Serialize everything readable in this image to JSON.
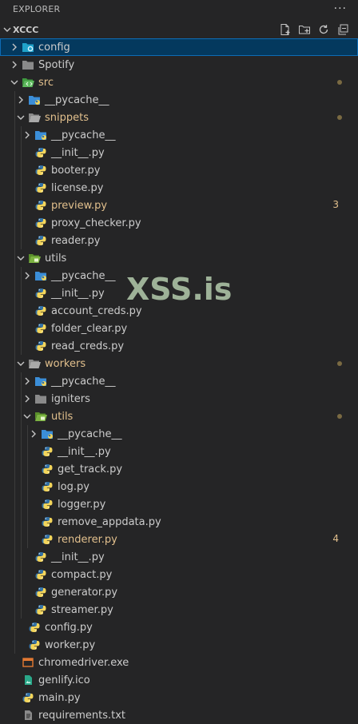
{
  "header": {
    "title": "EXPLORER",
    "more": "···"
  },
  "workspace": {
    "name": "XCCC"
  },
  "watermark": "XSS.is",
  "colors": {
    "modified": "#e2c08d",
    "normal": "#cccccc",
    "selected": "#04395e",
    "folder": "#c09553",
    "python_blue": "#3572A5",
    "python_yellow": "#f3d55b"
  },
  "tree": [
    {
      "label": "config",
      "depth": 1,
      "kind": "folder-config",
      "expanded": false,
      "selected": true,
      "status": "normal"
    },
    {
      "label": "Spotify",
      "depth": 1,
      "kind": "folder",
      "expanded": false,
      "status": "normal"
    },
    {
      "label": "src",
      "depth": 1,
      "kind": "folder-src",
      "expanded": true,
      "status": "modified",
      "dot": true
    },
    {
      "label": "__pycache__",
      "depth": 2,
      "kind": "folder-pycache",
      "expanded": false,
      "status": "normal"
    },
    {
      "label": "snippets",
      "depth": 2,
      "kind": "folder",
      "expanded": true,
      "status": "modified",
      "dot": true
    },
    {
      "label": "__pycache__",
      "depth": 3,
      "kind": "folder-pycache",
      "expanded": false,
      "status": "normal"
    },
    {
      "label": "__init__.py",
      "depth": 3,
      "kind": "python",
      "status": "normal"
    },
    {
      "label": "booter.py",
      "depth": 3,
      "kind": "python",
      "status": "normal"
    },
    {
      "label": "license.py",
      "depth": 3,
      "kind": "python",
      "status": "normal"
    },
    {
      "label": "preview.py",
      "depth": 3,
      "kind": "python",
      "status": "modified",
      "count": "3"
    },
    {
      "label": "proxy_checker.py",
      "depth": 3,
      "kind": "python",
      "status": "normal"
    },
    {
      "label": "reader.py",
      "depth": 3,
      "kind": "python",
      "status": "normal"
    },
    {
      "label": "utils",
      "depth": 2,
      "kind": "folder-utils",
      "expanded": true,
      "status": "normal"
    },
    {
      "label": "__pycache__",
      "depth": 3,
      "kind": "folder-pycache",
      "expanded": false,
      "status": "normal"
    },
    {
      "label": "__init__.py",
      "depth": 3,
      "kind": "python",
      "status": "normal"
    },
    {
      "label": "account_creds.py",
      "depth": 3,
      "kind": "python",
      "status": "normal"
    },
    {
      "label": "folder_clear.py",
      "depth": 3,
      "kind": "python",
      "status": "normal"
    },
    {
      "label": "read_creds.py",
      "depth": 3,
      "kind": "python",
      "status": "normal"
    },
    {
      "label": "workers",
      "depth": 2,
      "kind": "folder",
      "expanded": true,
      "status": "modified",
      "dot": true
    },
    {
      "label": "__pycache__",
      "depth": 3,
      "kind": "folder-pycache",
      "expanded": false,
      "status": "normal"
    },
    {
      "label": "igniters",
      "depth": 3,
      "kind": "folder",
      "expanded": false,
      "status": "normal"
    },
    {
      "label": "utils",
      "depth": 3,
      "kind": "folder-utils",
      "expanded": true,
      "status": "modified",
      "dot": true
    },
    {
      "label": "__pycache__",
      "depth": 4,
      "kind": "folder-pycache",
      "expanded": false,
      "status": "normal"
    },
    {
      "label": "__init__.py",
      "depth": 4,
      "kind": "python",
      "status": "normal"
    },
    {
      "label": "get_track.py",
      "depth": 4,
      "kind": "python",
      "status": "normal"
    },
    {
      "label": "log.py",
      "depth": 4,
      "kind": "python",
      "status": "normal"
    },
    {
      "label": "logger.py",
      "depth": 4,
      "kind": "python",
      "status": "normal"
    },
    {
      "label": "remove_appdata.py",
      "depth": 4,
      "kind": "python",
      "status": "normal"
    },
    {
      "label": "renderer.py",
      "depth": 4,
      "kind": "python",
      "status": "modified",
      "count": "4"
    },
    {
      "label": "__init__.py",
      "depth": 3,
      "kind": "python",
      "status": "normal"
    },
    {
      "label": "compact.py",
      "depth": 3,
      "kind": "python",
      "status": "normal"
    },
    {
      "label": "generator.py",
      "depth": 3,
      "kind": "python",
      "status": "normal"
    },
    {
      "label": "streamer.py",
      "depth": 3,
      "kind": "python",
      "status": "normal"
    },
    {
      "label": "config.py",
      "depth": 2,
      "kind": "python",
      "status": "normal"
    },
    {
      "label": "worker.py",
      "depth": 2,
      "kind": "python",
      "status": "normal"
    },
    {
      "label": "chromedriver.exe",
      "depth": 1,
      "kind": "exe",
      "status": "normal"
    },
    {
      "label": "genlify.ico",
      "depth": 1,
      "kind": "image",
      "status": "normal"
    },
    {
      "label": "main.py",
      "depth": 1,
      "kind": "python",
      "status": "normal"
    },
    {
      "label": "requirements.txt",
      "depth": 1,
      "kind": "text",
      "status": "normal"
    }
  ]
}
